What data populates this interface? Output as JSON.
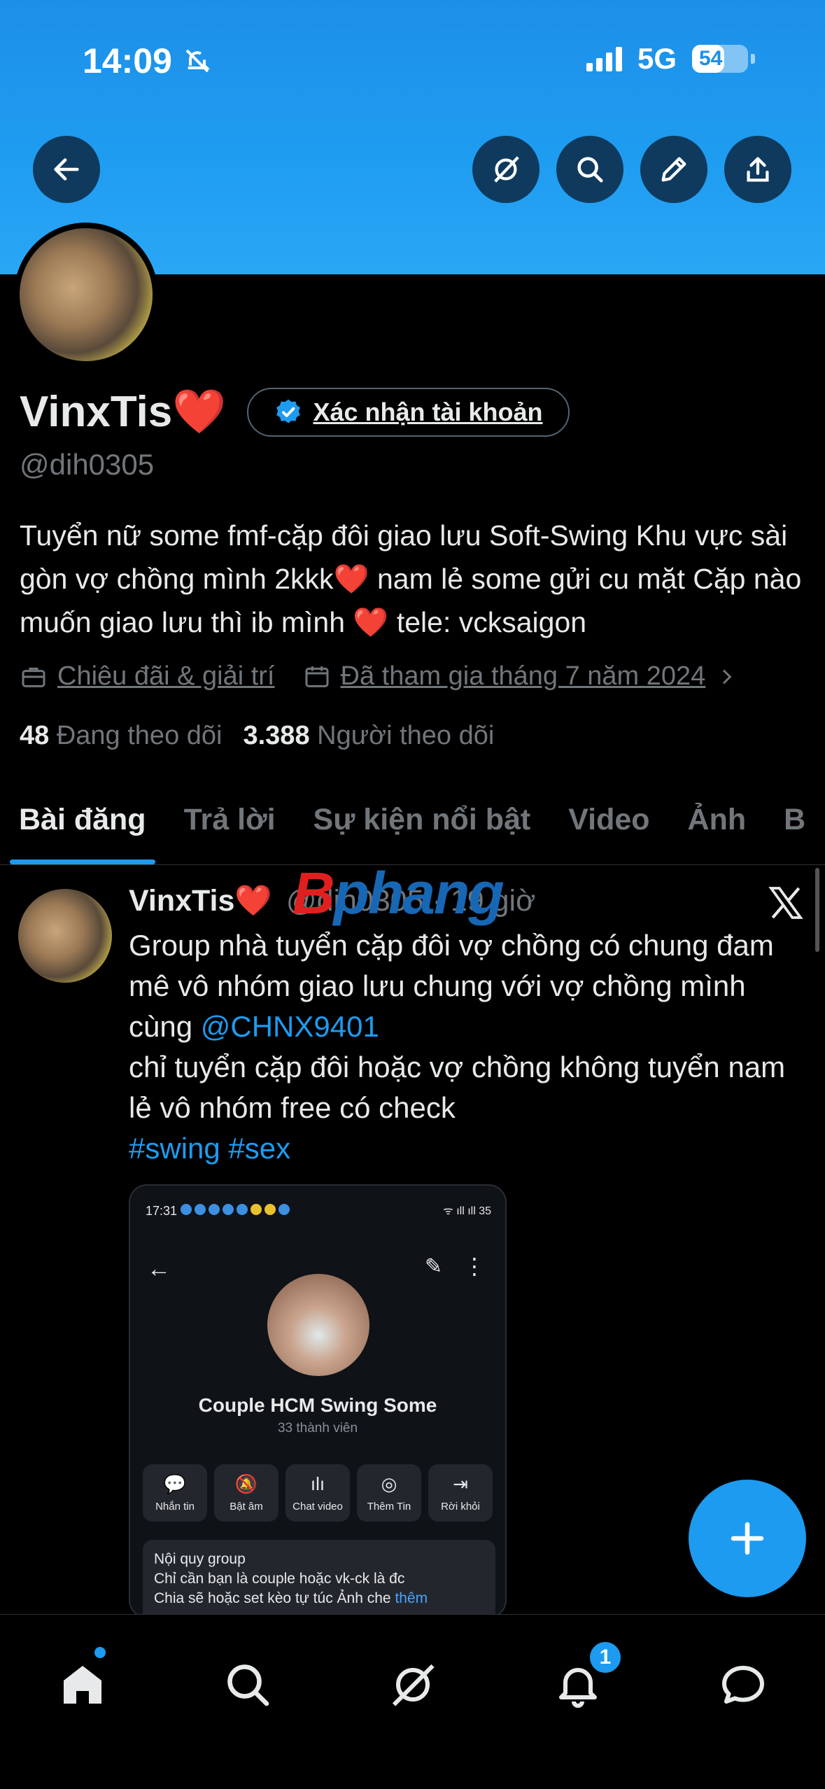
{
  "status_bar": {
    "time": "14:09",
    "network": "5G",
    "battery": "54"
  },
  "profile": {
    "display_name": "VinxTis❤️",
    "verify_label": "Xác nhận tài khoản",
    "handle": "@dih0305",
    "bio": "Tuyển nữ some fmf-cặp đôi giao lưu Soft-Swing Khu vực sài gòn vợ chồng mình 2kkk❤️ nam lẻ some gửi cu mặt Cặp nào muốn giao lưu thì ib mình ❤️ tele: vcksaigon",
    "category": "Chiêu đãi & giải trí",
    "joined": "Đã tham gia tháng 7 năm 2024",
    "following_count": "48",
    "following_label": "Đang theo dõi",
    "followers_count": "3.388",
    "followers_label": "Người theo dõi"
  },
  "tabs": [
    {
      "label": "Bài đăng"
    },
    {
      "label": "Trả lời"
    },
    {
      "label": "Sự kiện nổi bật"
    },
    {
      "label": "Video"
    },
    {
      "label": "Ảnh"
    },
    {
      "label": "B"
    }
  ],
  "post": {
    "author": "VinxTis❤️",
    "handle_time": "@dih0305 · 19 giờ",
    "text_line1": "Group nhà tuyển cặp đôi vợ chồng có chung đam mê vô nhóm giao lưu chung với vợ chồng mình cùng ",
    "mention": "@CHNX9401",
    "text_line2": "chỉ tuyển cặp đôi hoặc vợ chồng không tuyển nam lẻ vô nhóm free có check",
    "hashtags": "#swing #sex",
    "watermark_a": "B",
    "watermark_b": "phang",
    "embedded": {
      "time": "17:31",
      "battery": "35",
      "group_name": "Couple HCM Swing Some",
      "members": "33 thành viên",
      "actions": [
        "Nhắn tin",
        "Bật âm",
        "Chat video",
        "Thêm Tin",
        "Rời khỏi"
      ],
      "rules_title": "Nội quy group",
      "rules_line1": "Chỉ cần bạn là couple hoặc vk-ck là đc",
      "rules_line2": "Chia sẽ hoặc set kèo tự túc Ảnh che",
      "rules_more": "thêm"
    }
  },
  "nav": {
    "notification_count": "1"
  },
  "colors": {
    "accent": "#1d9bf0",
    "banner": "#1e9cf0",
    "muted": "#71767b"
  }
}
